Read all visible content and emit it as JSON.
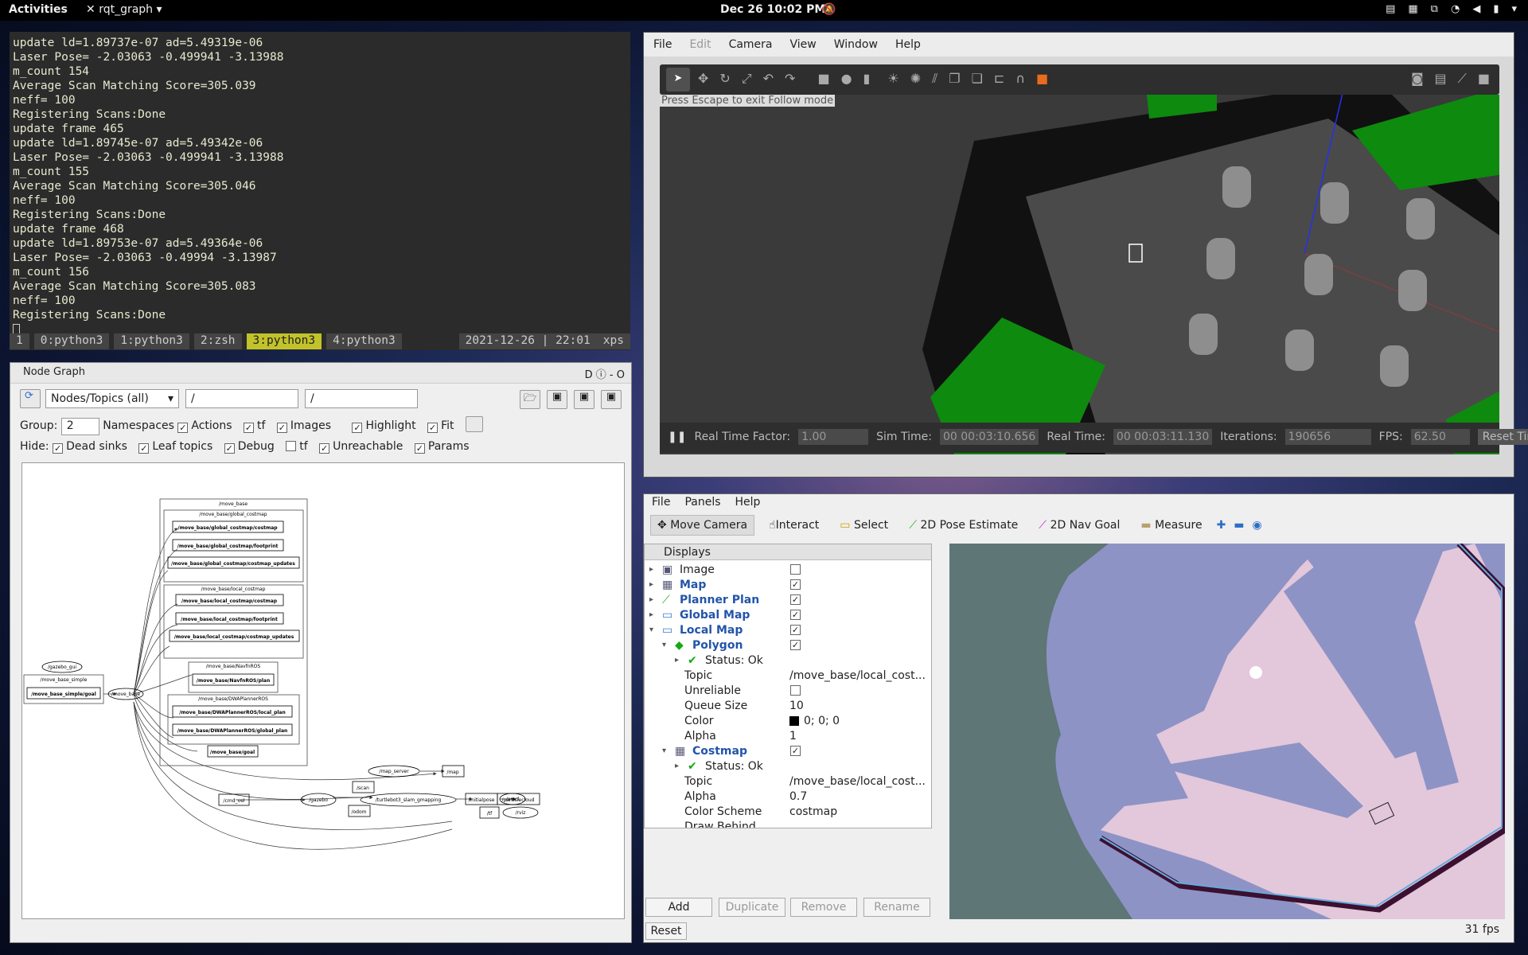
{
  "topbar": {
    "activities": "Activities",
    "app": "rqt_graph",
    "clock": "Dec 26  10:02 PM"
  },
  "terminal": {
    "lines": [
      "update ld=1.89737e-07 ad=5.49319e-06",
      "Laser Pose= -2.03063 -0.499941 -3.13988",
      "m_count 154",
      "Average Scan Matching Score=305.039",
      "neff= 100",
      "Registering Scans:Done",
      "update frame 465",
      "update ld=1.89745e-07 ad=5.49342e-06",
      "Laser Pose= -2.03063 -0.499941 -3.13988",
      "m_count 155",
      "Average Scan Matching Score=305.046",
      "neff= 100",
      "Registering Scans:Done",
      "update frame 468",
      "update ld=1.89753e-07 ad=5.49364e-06",
      "Laser Pose= -2.03063 -0.49994 -3.13987",
      "m_count 156",
      "Average Scan Matching Score=305.083",
      "neff= 100",
      "Registering Scans:Done"
    ],
    "tmux": {
      "session": "1",
      "w0": "0:python3",
      "w1": "1:python3",
      "w2": "2:zsh",
      "w3": "3:python3",
      "w4": "4:python3",
      "date": "2021-12-26 | 22:01",
      "host": "xps"
    }
  },
  "nodegraph": {
    "title": "Node Graph",
    "mode": "Nodes/Topics (all)",
    "filter1": "/",
    "filter2": "/",
    "group_label": "Group:",
    "group_value": "2",
    "namespaces": "Namespaces",
    "actions": "Actions",
    "tf": "tf",
    "images": "Images",
    "highlight": "Highlight",
    "fit": "Fit",
    "hide_label": "Hide:",
    "dead_sinks": "Dead sinks",
    "leaf_topics": "Leaf topics",
    "debug": "Debug",
    "tf2": "tf",
    "unreachable": "Unreachable",
    "params": "Params",
    "graph": {
      "move_base": "/move_base",
      "global_costmap": "/move_base/global_costmap",
      "gc_costmap": "/move_base/global_costmap/costmap",
      "gc_footprint": "/move_base/global_costmap/footprint",
      "gc_updates": "/move_base/global_costmap/costmap_updates",
      "local_costmap": "/move_base/local_costmap",
      "lc_costmap": "/move_base/local_costmap/costmap",
      "lc_footprint": "/move_base/local_costmap/footprint",
      "lc_updates": "/move_base/local_costmap/costmap_updates",
      "navfn": "/move_base/NavfnROS",
      "navfn_plan": "/move_base/NavfnROS/plan",
      "dwa": "/move_base/DWAPlannerROS",
      "dwa_local": "/move_base/DWAPlannerROS/local_plan",
      "dwa_global": "/move_base/DWAPlannerROS/global_plan",
      "goal": "/move_base/goal",
      "gazebo_gui": "/gazebo_gui",
      "mbs": "/move_base_simple",
      "mbs_goal": "/move_base_simple/goal",
      "move_base_node": "/move_base",
      "map_server": "/map_server",
      "map": "/map",
      "scan": "/scan",
      "cmd_vel": "/cmd_vel",
      "gazebo": "/gazebo",
      "slam": "/turtlebot3_slam_gmapping",
      "initialpose": "/initialpose",
      "amcl": "/amcl",
      "particlecloud": "/particlecloud",
      "odom": "/odom",
      "tf": "/tf",
      "rviz": "/rviz"
    }
  },
  "gazebo": {
    "menu": {
      "file": "File",
      "edit": "Edit",
      "camera": "Camera",
      "view": "View",
      "window": "Window",
      "help": "Help"
    },
    "follow_hint": "Press Escape to exit Follow mode",
    "status": {
      "rtf_label": "Real Time Factor:",
      "rtf": "1.00",
      "sim_label": "Sim Time:",
      "sim": "00 00:03:10.656",
      "real_label": "Real Time:",
      "real": "00 00:03:11.130",
      "it_label": "Iterations:",
      "it": "190656",
      "fps_label": "FPS:",
      "fps": "62.50",
      "reset": "Reset Time"
    }
  },
  "rviz": {
    "menu": {
      "file": "File",
      "panels": "Panels",
      "help": "Help"
    },
    "tools": {
      "move": "Move Camera",
      "interact": "Interact",
      "select": "Select",
      "pose": "2D Pose Estimate",
      "nav": "2D Nav Goal",
      "measure": "Measure"
    },
    "displays": {
      "title": "Displays",
      "rows": [
        {
          "name": "Image",
          "val": ""
        },
        {
          "name": "Map",
          "val": ""
        },
        {
          "name": "Planner Plan",
          "val": ""
        },
        {
          "name": "Global Map",
          "val": ""
        },
        {
          "name": "Local Map",
          "val": ""
        },
        {
          "name": "Polygon",
          "val": ""
        },
        {
          "name": "Status: Ok",
          "val": ""
        },
        {
          "name": "Topic",
          "val": "/move_base/local_cost..."
        },
        {
          "name": "Unreliable",
          "val": ""
        },
        {
          "name": "Queue Size",
          "val": "10"
        },
        {
          "name": "Color",
          "val": "0; 0; 0"
        },
        {
          "name": "Alpha",
          "val": "1"
        },
        {
          "name": "Costmap",
          "val": ""
        },
        {
          "name": "Status: Ok",
          "val": ""
        },
        {
          "name": "Topic",
          "val": "/move_base/local_cost..."
        },
        {
          "name": "Alpha",
          "val": "0.7"
        },
        {
          "name": "Color Scheme",
          "val": "costmap"
        },
        {
          "name": "Draw Behind",
          "val": ""
        }
      ]
    },
    "buttons": {
      "add": "Add",
      "duplicate": "Duplicate",
      "remove": "Remove",
      "rename": "Rename",
      "reset": "Reset"
    },
    "fps": "31 fps"
  }
}
